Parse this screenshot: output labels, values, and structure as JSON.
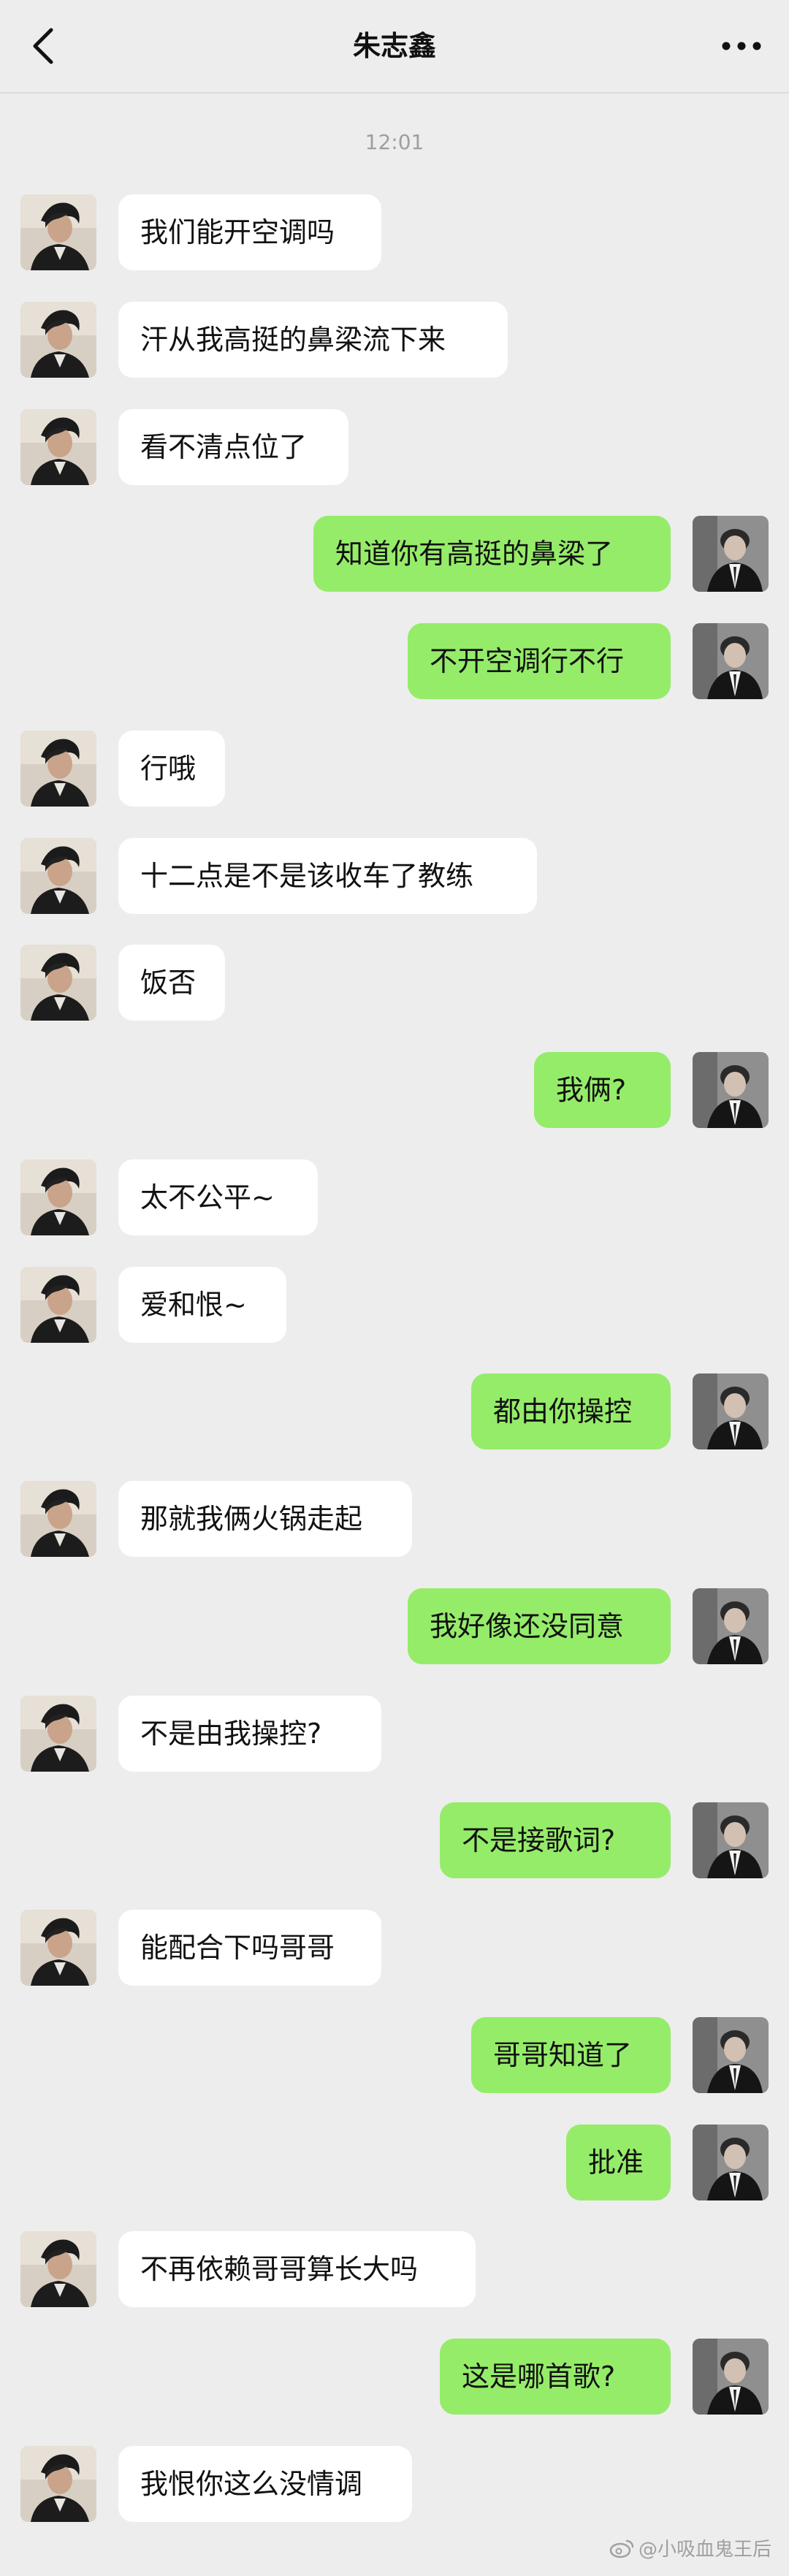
{
  "header": {
    "title": "朱志鑫"
  },
  "timestamp": "12:01",
  "messages": [
    {
      "side": "left",
      "text": "我们能开空调吗"
    },
    {
      "side": "left",
      "text": "汗从我高挺的鼻梁流下来"
    },
    {
      "side": "left",
      "text": "看不清点位了"
    },
    {
      "side": "right",
      "text": "知道你有高挺的鼻梁了"
    },
    {
      "side": "right",
      "text": "不开空调行不行"
    },
    {
      "side": "left",
      "text": "行哦"
    },
    {
      "side": "left",
      "text": "十二点是不是该收车了教练"
    },
    {
      "side": "left",
      "text": "饭否"
    },
    {
      "side": "right",
      "text": "我俩?"
    },
    {
      "side": "left",
      "text": "太不公平~"
    },
    {
      "side": "left",
      "text": "爱和恨~"
    },
    {
      "side": "right",
      "text": "都由你操控"
    },
    {
      "side": "left",
      "text": "那就我俩火锅走起"
    },
    {
      "side": "right",
      "text": "我好像还没同意"
    },
    {
      "side": "left",
      "text": "不是由我操控?"
    },
    {
      "side": "right",
      "text": "不是接歌词?"
    },
    {
      "side": "left",
      "text": "能配合下吗哥哥"
    },
    {
      "side": "right",
      "text": "哥哥知道了"
    },
    {
      "side": "right",
      "text": "批准"
    },
    {
      "side": "left",
      "text": "不再依赖哥哥算长大吗"
    },
    {
      "side": "right",
      "text": "这是哪首歌?"
    },
    {
      "side": "left",
      "text": "我恨你这么没情调"
    }
  ],
  "watermark": "@小吸血鬼王后",
  "colors": {
    "background": "#ededed",
    "bubble_self": "#95ec69",
    "bubble_other": "#ffffff"
  },
  "icons": {
    "back": "chevron-left-icon",
    "more": "more-dots-icon",
    "watermark": "weibo-icon"
  }
}
